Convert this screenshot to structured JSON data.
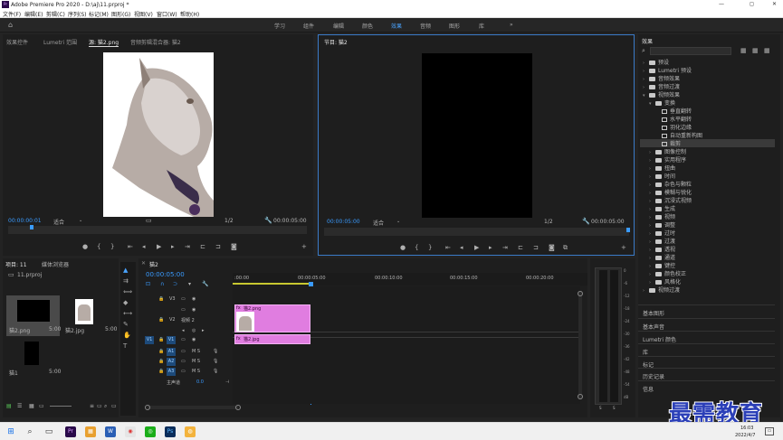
{
  "titlebar": {
    "title": "Adobe Premiere Pro 2020 - D:\\aj\\11.prproj *",
    "logo": "Pr",
    "min": "—",
    "max": "◻",
    "close": "✕"
  },
  "menu": [
    "文件(F)",
    "编辑(E)",
    "剪辑(C)",
    "序列(S)",
    "标记(M)",
    "图形(G)",
    "视图(V)",
    "窗口(W)",
    "帮助(H)"
  ],
  "workspaces": {
    "items": [
      "学习",
      "组件",
      "编辑",
      "颜色",
      "效果",
      "音频",
      "图形",
      "库"
    ],
    "active_index": 4,
    "more": "»"
  },
  "source": {
    "tabs": [
      "效果控件",
      "Lumetri 范围",
      "源: 猫2.png",
      "音频剪辑混合器: 猫2"
    ],
    "active_tab": 2,
    "timecode": "00:00:00:01",
    "fit": "适合",
    "ratio": "1/2",
    "duration": "00:00:05:00"
  },
  "program": {
    "title": "节目: 猫2",
    "timecode": "00:00:05:00",
    "fit": "适合",
    "ratio": "1/2",
    "duration": "00:00:05:00"
  },
  "effects": {
    "title": "效果",
    "tree": [
      {
        "label": "预设",
        "kind": "folder",
        "indent": 0,
        "open": false
      },
      {
        "label": "Lumetri 预设",
        "kind": "folder",
        "indent": 0,
        "open": false
      },
      {
        "label": "音频效果",
        "kind": "folder",
        "indent": 0,
        "open": false
      },
      {
        "label": "音频过渡",
        "kind": "folder",
        "indent": 0,
        "open": false
      },
      {
        "label": "视频效果",
        "kind": "folder",
        "indent": 0,
        "open": true
      },
      {
        "label": "变换",
        "kind": "folder",
        "indent": 1,
        "open": true
      },
      {
        "label": "垂直翻转",
        "kind": "preset",
        "indent": 2
      },
      {
        "label": "水平翻转",
        "kind": "preset",
        "indent": 2
      },
      {
        "label": "羽化边缘",
        "kind": "preset",
        "indent": 2
      },
      {
        "label": "自动重新构图",
        "kind": "preset",
        "indent": 2
      },
      {
        "label": "裁剪",
        "kind": "preset",
        "indent": 2,
        "selected": true
      },
      {
        "label": "图像控制",
        "kind": "folder",
        "indent": 1,
        "open": false
      },
      {
        "label": "实用程序",
        "kind": "folder",
        "indent": 1,
        "open": false
      },
      {
        "label": "扭曲",
        "kind": "folder",
        "indent": 1,
        "open": false
      },
      {
        "label": "时间",
        "kind": "folder",
        "indent": 1,
        "open": false
      },
      {
        "label": "杂色与颗粒",
        "kind": "folder",
        "indent": 1,
        "open": false
      },
      {
        "label": "模糊与锐化",
        "kind": "folder",
        "indent": 1,
        "open": false
      },
      {
        "label": "沉浸式视频",
        "kind": "folder",
        "indent": 1,
        "open": false
      },
      {
        "label": "生成",
        "kind": "folder",
        "indent": 1,
        "open": false
      },
      {
        "label": "视频",
        "kind": "folder",
        "indent": 1,
        "open": false
      },
      {
        "label": "调整",
        "kind": "folder",
        "indent": 1,
        "open": false
      },
      {
        "label": "过时",
        "kind": "folder",
        "indent": 1,
        "open": false
      },
      {
        "label": "过渡",
        "kind": "folder",
        "indent": 1,
        "open": false
      },
      {
        "label": "透视",
        "kind": "folder",
        "indent": 1,
        "open": false
      },
      {
        "label": "通道",
        "kind": "folder",
        "indent": 1,
        "open": false
      },
      {
        "label": "键控",
        "kind": "folder",
        "indent": 1,
        "open": false
      },
      {
        "label": "颜色校正",
        "kind": "folder",
        "indent": 1,
        "open": false
      },
      {
        "label": "风格化",
        "kind": "folder",
        "indent": 1,
        "open": false
      },
      {
        "label": "视频过渡",
        "kind": "folder",
        "indent": 0,
        "open": false
      }
    ],
    "sections": [
      "基本图形",
      "基本声音",
      "Lumetri 颜色",
      "库",
      "标记",
      "历史记录",
      "信息"
    ]
  },
  "project": {
    "tabs": [
      "项目: 11",
      "媒体浏览器"
    ],
    "file": "11.prproj",
    "items": [
      {
        "name": "猫2.png",
        "dur": "5:00"
      },
      {
        "name": "猫2.jpg",
        "dur": "5:00"
      },
      {
        "name": "猫1",
        "dur": "5:00"
      }
    ]
  },
  "timeline": {
    "tab": "猫2",
    "timecode": "00:00:05:00",
    "ruler": [
      ":00:00",
      "00:00:05:00",
      "00:00:10:00",
      "00:00:15:00",
      "00:00:20:00"
    ],
    "tracks": [
      {
        "id": "V3",
        "label": ""
      },
      {
        "id": "V2",
        "label": "视频 2"
      },
      {
        "id": "V1",
        "label": ""
      },
      {
        "id": "A1",
        "label": "M S"
      },
      {
        "id": "A2",
        "label": "M S"
      },
      {
        "id": "A3",
        "label": "M S"
      }
    ],
    "master": "主声道",
    "master_val": "0.0",
    "clips": [
      {
        "name": "猫2.png"
      },
      {
        "name": "猫2.jpg"
      }
    ]
  },
  "meter_scale": [
    "0",
    "-6",
    "-12",
    "-18",
    "-24",
    "-30",
    "-36",
    "-42",
    "-48",
    "-54",
    "dB"
  ],
  "meter_bottom": [
    "S",
    "S"
  ],
  "taskbar": {
    "time": "16:03",
    "date": "2022/4/7"
  },
  "watermark": "最需教育",
  "colors": {
    "accent": "#3a9bff",
    "clip": "#e07de0",
    "selected_track": "#1d4a7a"
  }
}
